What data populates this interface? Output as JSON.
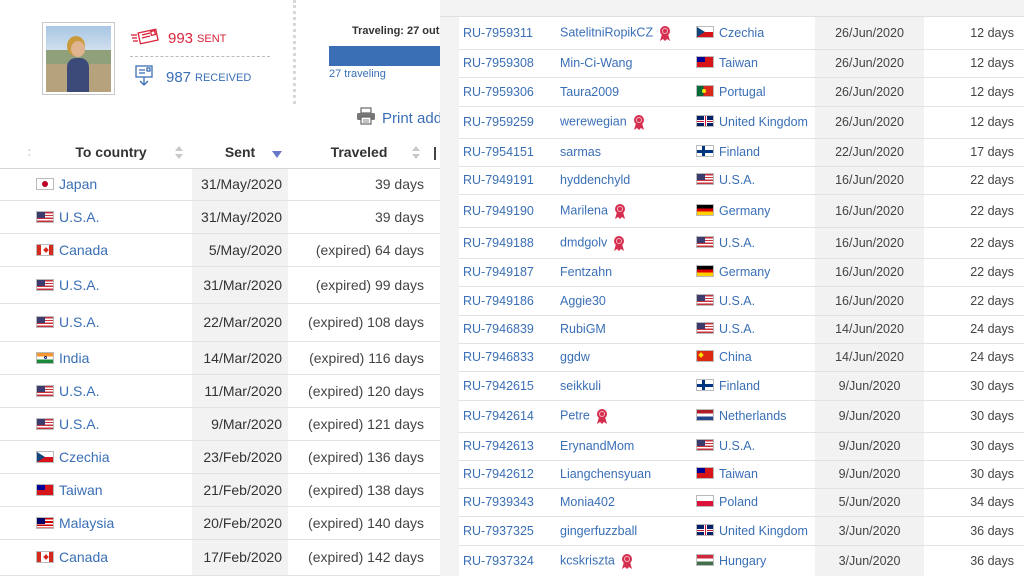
{
  "profile": {
    "sent_count": "993",
    "sent_label": "SENT",
    "received_count": "987",
    "received_label": "RECEIVED",
    "traveling_title": "Traveling: 27 out",
    "traveling_count": "27 traveling",
    "print_label": "Print add"
  },
  "colors": {
    "sent": "#d9243a",
    "received": "#3a6fb6",
    "link": "#3a6fb6"
  },
  "left_table": {
    "headers": [
      "To country",
      "Sent",
      "Traveled"
    ],
    "rows": [
      {
        "country": "Japan",
        "flag": "jp",
        "sent": "31/May/2020",
        "traveled": "39 days"
      },
      {
        "country": "U.S.A.",
        "flag": "us",
        "sent": "31/May/2020",
        "traveled": "39 days"
      },
      {
        "country": "Canada",
        "flag": "ca",
        "sent": "5/May/2020",
        "traveled": "(expired) 64 days"
      },
      {
        "country": "U.S.A.",
        "flag": "us",
        "sent": "31/Mar/2020",
        "traveled": "(expired) 99 days"
      },
      {
        "country": "U.S.A.",
        "flag": "us",
        "sent": "22/Mar/2020",
        "traveled": "(expired) 108 days"
      },
      {
        "country": "India",
        "flag": "in",
        "sent": "14/Mar/2020",
        "traveled": "(expired) 116 days"
      },
      {
        "country": "U.S.A.",
        "flag": "us",
        "sent": "11/Mar/2020",
        "traveled": "(expired) 120 days"
      },
      {
        "country": "U.S.A.",
        "flag": "us",
        "sent": "9/Mar/2020",
        "traveled": "(expired) 121 days"
      },
      {
        "country": "Czechia",
        "flag": "cz",
        "sent": "23/Feb/2020",
        "traveled": "(expired) 136 days"
      },
      {
        "country": "Taiwan",
        "flag": "tw",
        "sent": "21/Feb/2020",
        "traveled": "(expired) 138 days"
      },
      {
        "country": "Malaysia",
        "flag": "my",
        "sent": "20/Feb/2020",
        "traveled": "(expired) 140 days"
      },
      {
        "country": "Canada",
        "flag": "ca",
        "sent": "17/Feb/2020",
        "traveled": "(expired) 142 days"
      }
    ]
  },
  "right_table": {
    "rows": [
      {
        "id": "RU-7959311",
        "user": "SatelitniRopikCZ",
        "ribbon": true,
        "country": "Czechia",
        "flag": "cz",
        "date": "26/Jun/2020",
        "days": "12 days"
      },
      {
        "id": "RU-7959308",
        "user": "Min-Ci-Wang",
        "ribbon": false,
        "country": "Taiwan",
        "flag": "tw",
        "date": "26/Jun/2020",
        "days": "12 days"
      },
      {
        "id": "RU-7959306",
        "user": "Taura2009",
        "ribbon": false,
        "country": "Portugal",
        "flag": "pt",
        "date": "26/Jun/2020",
        "days": "12 days"
      },
      {
        "id": "RU-7959259",
        "user": "werewegian",
        "ribbon": true,
        "country": "United Kingdom",
        "flag": "gb",
        "date": "26/Jun/2020",
        "days": "12 days"
      },
      {
        "id": "RU-7954151",
        "user": "sarmas",
        "ribbon": false,
        "country": "Finland",
        "flag": "fi",
        "date": "22/Jun/2020",
        "days": "17 days"
      },
      {
        "id": "RU-7949191",
        "user": "hyddenchyld",
        "ribbon": false,
        "country": "U.S.A.",
        "flag": "us",
        "date": "16/Jun/2020",
        "days": "22 days"
      },
      {
        "id": "RU-7949190",
        "user": "Marilena",
        "ribbon": true,
        "country": "Germany",
        "flag": "de",
        "date": "16/Jun/2020",
        "days": "22 days"
      },
      {
        "id": "RU-7949188",
        "user": "dmdgolv",
        "ribbon": true,
        "country": "U.S.A.",
        "flag": "us",
        "date": "16/Jun/2020",
        "days": "22 days"
      },
      {
        "id": "RU-7949187",
        "user": "Fentzahn",
        "ribbon": false,
        "country": "Germany",
        "flag": "de",
        "date": "16/Jun/2020",
        "days": "22 days"
      },
      {
        "id": "RU-7949186",
        "user": "Aggie30",
        "ribbon": false,
        "country": "U.S.A.",
        "flag": "us",
        "date": "16/Jun/2020",
        "days": "22 days"
      },
      {
        "id": "RU-7946839",
        "user": "RubiGM",
        "ribbon": false,
        "country": "U.S.A.",
        "flag": "us",
        "date": "14/Jun/2020",
        "days": "24 days"
      },
      {
        "id": "RU-7946833",
        "user": "ggdw",
        "ribbon": false,
        "country": "China",
        "flag": "cn",
        "date": "14/Jun/2020",
        "days": "24 days"
      },
      {
        "id": "RU-7942615",
        "user": "seikkuli",
        "ribbon": false,
        "country": "Finland",
        "flag": "fi",
        "date": "9/Jun/2020",
        "days": "30 days"
      },
      {
        "id": "RU-7942614",
        "user": "Petre",
        "ribbon": true,
        "country": "Netherlands",
        "flag": "nl",
        "date": "9/Jun/2020",
        "days": "30 days"
      },
      {
        "id": "RU-7942613",
        "user": "ErynandMom",
        "ribbon": false,
        "country": "U.S.A.",
        "flag": "us",
        "date": "9/Jun/2020",
        "days": "30 days"
      },
      {
        "id": "RU-7942612",
        "user": "Liangchensyuan",
        "ribbon": false,
        "country": "Taiwan",
        "flag": "tw",
        "date": "9/Jun/2020",
        "days": "30 days"
      },
      {
        "id": "RU-7939343",
        "user": "Monia402",
        "ribbon": false,
        "country": "Poland",
        "flag": "pl",
        "date": "5/Jun/2020",
        "days": "34 days"
      },
      {
        "id": "RU-7937325",
        "user": "gingerfuzzball",
        "ribbon": false,
        "country": "United Kingdom",
        "flag": "gb",
        "date": "3/Jun/2020",
        "days": "36 days"
      },
      {
        "id": "RU-7937324",
        "user": "kcskriszta",
        "ribbon": true,
        "country": "Hungary",
        "flag": "hu",
        "date": "3/Jun/2020",
        "days": "36 days"
      }
    ]
  }
}
